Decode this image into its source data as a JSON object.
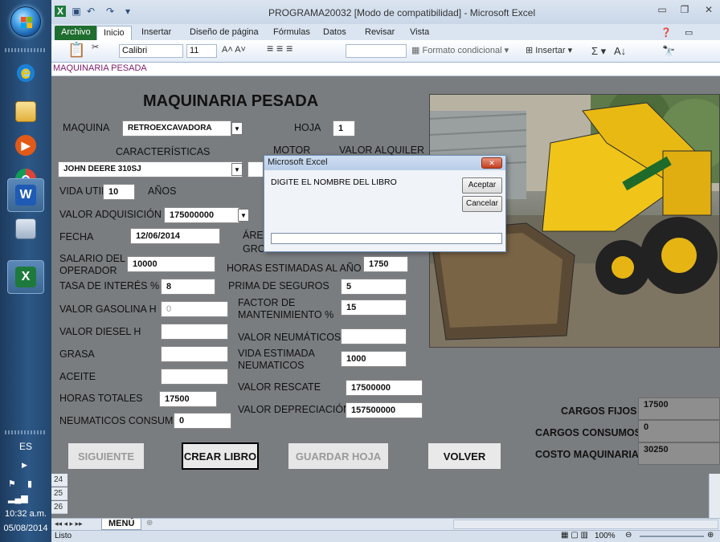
{
  "taskbar": {
    "language": "ES",
    "clock_time": "10:32 a.m.",
    "clock_date": "05/08/2014"
  },
  "window": {
    "title": "PROGRAMA20032  [Modo de compatibilidad]  -  Microsoft Excel"
  },
  "ribbon": {
    "tabs": [
      "Archivo",
      "Inicio",
      "Insertar",
      "Diseño de página",
      "Fórmulas",
      "Datos",
      "Revisar",
      "Vista"
    ],
    "font_name": "Calibri",
    "font_size": "11",
    "conditional_format": "Formato condicional",
    "insert": "Insertar",
    "sum_symbol": "Σ"
  },
  "namebox": "MAQUINARIA PESADA",
  "form": {
    "title": "MAQUINARIA PESADA",
    "maquina_label": "MAQUINA",
    "maquina_value": "RETROEXCAVADORA",
    "hoja_label": "HOJA",
    "hoja_value": "1",
    "caracteristicas_label": "CARACTERÍSTICAS",
    "motor_label": "MOTOR",
    "valor_alquiler_label": "VALOR ALQUILER",
    "model_value": "JOHN DEERE 310SJ",
    "vida_util_label": "VIDA UTIL",
    "vida_util_value": "10",
    "anos_label": "AÑOS",
    "valor_adquisicion_label": "VALOR ADQUISICIÓN",
    "valor_adquisicion_value": "175000000",
    "fecha_label": "FECHA",
    "fecha_value": "12/06/2014",
    "area_label": "ÁRE",
    "gro_label": "GRO",
    "salario_label_1": "SALARIO DEL",
    "salario_label_2": "OPERADOR",
    "salario_value": "10000",
    "horas_estimadas_label": "HORAS ESTIMADAS AL AÑO",
    "horas_estimadas_value": "1750",
    "tasa_label": "TASA DE INTERÉS %",
    "tasa_value": "8",
    "prima_label": "PRIMA DE SEGUROS",
    "prima_value": "5",
    "gasolina_label": "VALOR GASOLINA H",
    "gasolina_value": "0",
    "factor_label_1": "FACTOR DE",
    "factor_label_2": "MANTENIMIENTO %",
    "factor_value": "15",
    "diesel_label": "VALOR DIESEL H",
    "diesel_value": "",
    "neumaticos_label": "VALOR NEUMÁTICOS",
    "neumaticos_value": "",
    "grasa_label": "GRASA",
    "grasa_value": "",
    "vida_neum_label_1": "VIDA ESTIMADA",
    "vida_neum_label_2": "NEUMATICOS",
    "vida_neum_value": "1000",
    "aceite_label": "ACEITE",
    "aceite_value": "",
    "rescate_label": "VALOR RESCATE",
    "rescate_value": "17500000",
    "horas_totales_label": "HORAS TOTALES",
    "horas_totales_value": "17500",
    "depreciacion_label": "VALOR DEPRECIACIÓN",
    "depreciacion_value": "157500000",
    "neum_consumo_label": "NEUMATICOS CONSUMO",
    "neum_consumo_value": "0",
    "cargos_fijos_label": "CARGOS FIJOS",
    "cargos_fijos_value": "17500",
    "cargos_consumos_label": "CARGOS CONSUMOS",
    "cargos_consumos_value": "0",
    "costo_label": "COSTO MAQUINARIA",
    "costo_value": "30250"
  },
  "buttons": {
    "siguiente": "SIGUIENTE",
    "crear_libro": "CREAR LIBRO",
    "guardar_hoja": "GUARDAR HOJA",
    "volver": "VOLVER"
  },
  "dialog": {
    "title": "Microsoft Excel",
    "prompt": "DIGITE EL NOMBRE DEL LIBRO",
    "ok": "Aceptar",
    "cancel": "Cancelar",
    "input_value": ""
  },
  "rows": [
    "24",
    "25",
    "26"
  ],
  "sheet_tab": "MENÚ",
  "status": {
    "ready": "Listo",
    "zoom": "100%"
  }
}
